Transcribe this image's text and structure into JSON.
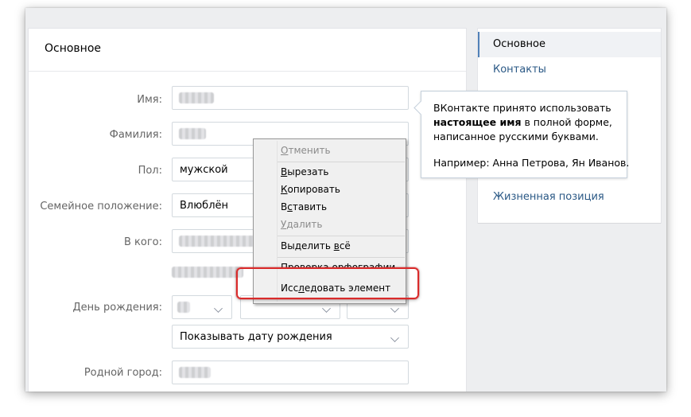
{
  "main": {
    "title": "Основное",
    "labels": {
      "first_name": "Имя:",
      "last_name": "Фамилия:",
      "gender": "Пол:",
      "relationship": "Семейное положение:",
      "partner": "В кого:",
      "birthday": "День рождения:",
      "hometown": "Родной город:"
    },
    "gender_value": "мужской",
    "relationship_value": "Влюблён",
    "birthday_visibility": "Показывать дату рождения"
  },
  "sidebar": {
    "items": [
      {
        "label": "Основное",
        "active": true
      },
      {
        "label": "Контакты",
        "active": false
      },
      {
        "label": "Жизненная позиция",
        "active": false
      }
    ]
  },
  "tooltip": {
    "line1": "ВКонтакте принято использовать",
    "line2_bold": "настоящее имя",
    "line2_rest": " в полной форме,",
    "line3": "написанное русскими буквами.",
    "line4": "Например: Анна Петрова, Ян Иванов."
  },
  "context_menu": {
    "undo": {
      "pre": "",
      "key": "О",
      "post": "тменить"
    },
    "cut": {
      "pre": "",
      "key": "В",
      "post": "ырезать"
    },
    "copy": {
      "pre": "",
      "key": "К",
      "post": "опировать"
    },
    "paste": {
      "pre": "В",
      "key": "с",
      "post": "тавить"
    },
    "delete": {
      "pre": "",
      "key": "У",
      "post": "далить"
    },
    "select_all": {
      "pre": "Выделить ",
      "key": "в",
      "post": "сё"
    },
    "spellcheck": "Проверка орфографии",
    "inspect": {
      "pre": "Исс",
      "key": "л",
      "post": "едовать элемент"
    }
  },
  "colors": {
    "link": "#2a5885",
    "active_indicator": "#5181b8",
    "highlight": "#d92b2b"
  }
}
